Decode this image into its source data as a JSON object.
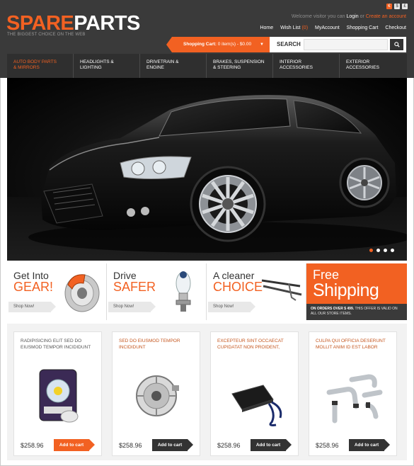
{
  "header": {
    "logo_part1": "SPARE",
    "logo_part2": "PARTS",
    "tagline": "THE BIGGEST CHOICE ON THE WEB",
    "languages": [
      "€",
      "$",
      "£"
    ],
    "welcome_text": "Welcome visitor you can",
    "login_label": "Login",
    "or_text": "or",
    "create_account_label": "Create an account",
    "links": [
      {
        "label": "Home"
      },
      {
        "label": "Wish List",
        "count": "(0)"
      },
      {
        "label": "MyAccount"
      },
      {
        "label": "Shopping Cart"
      },
      {
        "label": "Checkout"
      }
    ],
    "cart": {
      "label": "Shopping Cart:",
      "value": "0 item(s) - $0.00"
    },
    "search": {
      "label": "SEARCH",
      "placeholder": ""
    }
  },
  "nav": [
    {
      "label": "AUTO BODY PARTS\n& MIRRORS",
      "active": true
    },
    {
      "label": "HEADLIGHTS &\nLIGHTING"
    },
    {
      "label": "DRIVETRAIN &\nENGINE"
    },
    {
      "label": "BRAKES, SUSPENSION\n& STEERING"
    },
    {
      "label": "INTERIOR\nACCESSORIES"
    },
    {
      "label": "EXTERIOR\nACCESSORIES"
    }
  ],
  "hero": {
    "slides": 4,
    "active_slide": 1
  },
  "promos": [
    {
      "line1": "Get Into",
      "line2": "GEAR!",
      "button": "Shop Now!"
    },
    {
      "line1": "Drive",
      "line2": "SAFER",
      "button": "Shop Now!"
    },
    {
      "line1": "A cleaner",
      "line2": "CHOICE",
      "button": "Shop Now!"
    }
  ],
  "free_shipping": {
    "line1": "Free",
    "line2": "Shipping",
    "note_bold": "ON ORDERS OVER $ 499.",
    "note_rest": "THIS OFFER IS VALID ON ALL OUR STORE ITEMS."
  },
  "products": [
    {
      "desc": "RADIPISICING ELIT sed do eiusmod tempor incididunt",
      "price": "$258.96",
      "button": "Add to cart"
    },
    {
      "desc": "Sed do eiusmod TEMPOR INCIDIDUNT",
      "price": "$258.96",
      "button": "Add to cart"
    },
    {
      "desc": "Excepteur sint OCCAECAT CUPIDatat non proident,",
      "price": "$258.96",
      "button": "Add to cart"
    },
    {
      "desc": "Culpa qui officia DESERUNT MOLLIT ANIM ID EST LABOR",
      "price": "$258.96",
      "button": "Add to cart"
    }
  ],
  "colors": {
    "accent": "#f26122",
    "header_bg": "#3a3a3a",
    "nav_bg": "#2f2f2f"
  }
}
